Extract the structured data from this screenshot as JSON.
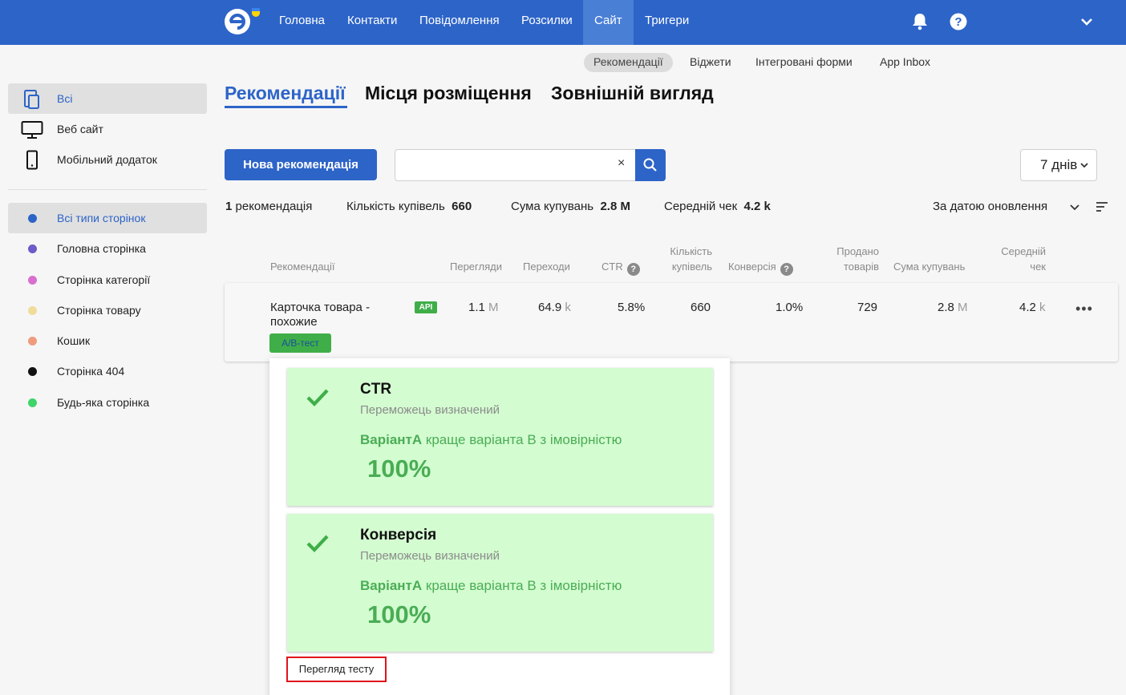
{
  "topnav": {
    "items": [
      "Головна",
      "Контакти",
      "Повідомлення",
      "Розсилки",
      "Сайт",
      "Тригери"
    ],
    "active": "Сайт"
  },
  "icons": {
    "logo": "esputnik-logo-icon",
    "bell": "bell-icon",
    "help": "help-circle-icon",
    "chevron": "chevron-down-icon",
    "search": "search-icon",
    "sort": "sort-lines-icon",
    "check": "check-icon"
  },
  "subtabs": {
    "items": [
      "Рекомендації",
      "Віджети",
      "Інтегровані форми",
      "App Inbox"
    ],
    "active": "Рекомендації"
  },
  "sidebar": {
    "devices": [
      "Всі",
      "Веб сайт",
      "Мобільний додаток"
    ],
    "page_types": [
      {
        "label": "Всі типи сторінок",
        "color": "#2d64c8"
      },
      {
        "label": "Головна сторінка",
        "color": "#6c5bc9"
      },
      {
        "label": "Сторінка категорії",
        "color": "#d86fd0"
      },
      {
        "label": "Сторінка товару",
        "color": "#f0dc9a"
      },
      {
        "label": "Кошик",
        "color": "#ee9b7e"
      },
      {
        "label": "Сторінка 404",
        "color": "#111111"
      },
      {
        "label": "Будь-яка сторінка",
        "color": "#3fd46a"
      }
    ]
  },
  "main": {
    "tabs": [
      "Рекомендації",
      "Місця розміщення",
      "Зовнішній вигляд"
    ],
    "new_button": "Нова рекомендація",
    "search": {
      "value": "",
      "placeholder": "",
      "clear": "×"
    },
    "period": "7 днів",
    "summary": {
      "count_value": "1",
      "count_label": "рекомендація",
      "purchases_label": "Кількість купівель",
      "purchases_value": "660",
      "sum_label": "Сума купувань",
      "sum_value": "2.8 M",
      "avg_label": "Середній чек",
      "avg_value": "4.2 k"
    },
    "sort_by": "За датою оновлення"
  },
  "table": {
    "headers": {
      "recommendations": "Рекомендації",
      "views": "Перегляди",
      "clicks": "Переходи",
      "ctr": "CTR",
      "purchases_1": "Кількість",
      "purchases_2": "купівель",
      "conversion": "Конверсія",
      "sold_1": "Продано",
      "sold_2": "товарів",
      "sum": "Сума купувань",
      "avg_1": "Середній",
      "avg_2": "чек",
      "help": "?"
    },
    "row": {
      "name": "Карточка товара - похожие",
      "api_badge": "API",
      "ab_badge": "A/B-тест",
      "views_num": "1.1",
      "views_unit": "M",
      "clicks_num": "64.9",
      "clicks_unit": "k",
      "ctr": "5.8%",
      "purchases": "660",
      "conversion": "1.0%",
      "sold": "729",
      "sum_num": "2.8",
      "sum_unit": "M",
      "avg_num": "4.2",
      "avg_unit": "k",
      "menu": "•••"
    }
  },
  "ab_popup": {
    "cards": [
      {
        "title": "CTR",
        "status": "Переможець визначений",
        "variant": "ВаріантA",
        "text": " краще варіанта B з імовірністю",
        "percent": "100%"
      },
      {
        "title": "Конверсія",
        "status": "Переможець визначений",
        "variant": "ВаріантA",
        "text": " краще варіанта B з імовірністю",
        "percent": "100%"
      }
    ],
    "view_test": "Перегляд тесту"
  }
}
